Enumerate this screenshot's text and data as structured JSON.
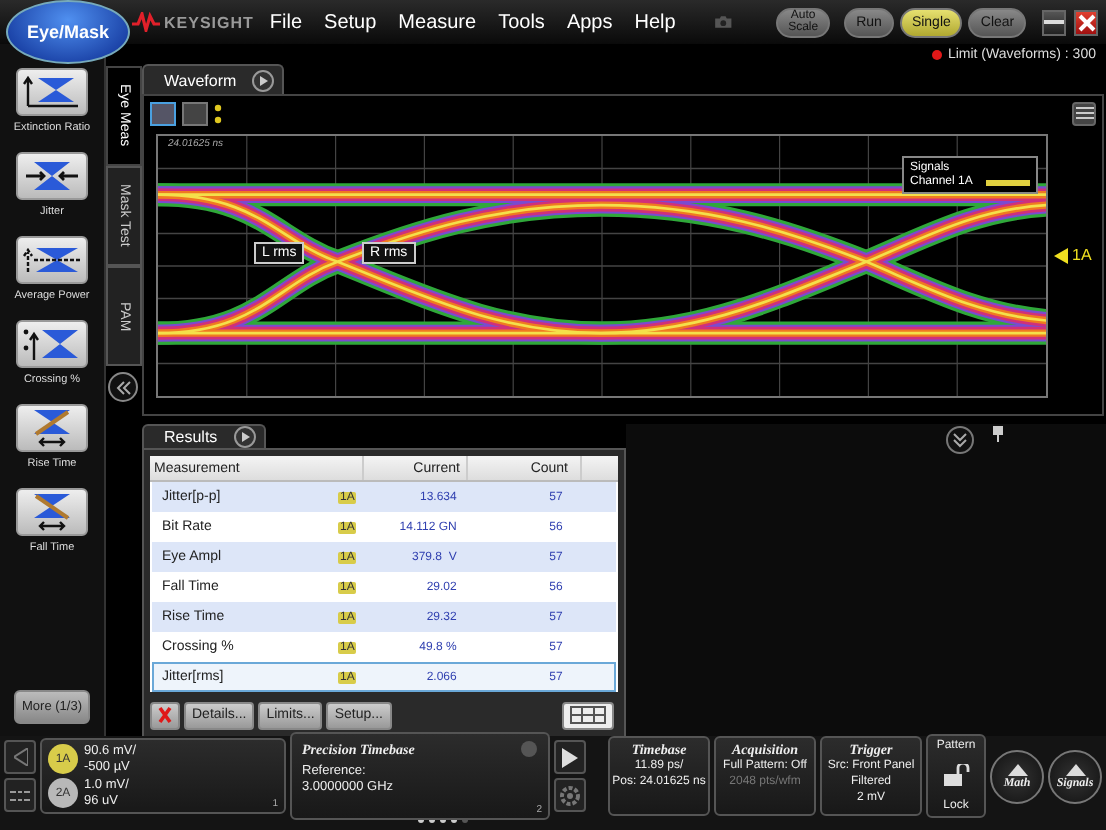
{
  "app_button": "Eye/Mask",
  "brand": "KEYSIGHT",
  "menu": [
    "File",
    "Setup",
    "Measure",
    "Tools",
    "Apps",
    "Help"
  ],
  "run_buttons": [
    {
      "label": "Auto Scale",
      "selected": false
    },
    {
      "label": "Run",
      "selected": false
    },
    {
      "label": "Single",
      "selected": true
    },
    {
      "label": "Clear",
      "selected": false
    }
  ],
  "limit_status": "Limit (Waveforms) : 300",
  "measure_buttons": [
    {
      "label": "Extinction Ratio",
      "kind": "extinction"
    },
    {
      "label": "Jitter",
      "kind": "jitter"
    },
    {
      "label": "Average Power",
      "kind": "power"
    },
    {
      "label": "Crossing %",
      "kind": "crossing"
    },
    {
      "label": "Rise Time",
      "kind": "rise"
    },
    {
      "label": "Fall Time",
      "kind": "fall"
    }
  ],
  "more_button": "More (1/3)",
  "side_tabs": [
    {
      "label": "Eye Meas",
      "selected": true
    },
    {
      "label": "Mask Test",
      "selected": false
    },
    {
      "label": "PAM",
      "selected": false
    }
  ],
  "waveform": {
    "tab": "Waveform",
    "timestamp": "24.01625 ns",
    "legend_title": "Signals",
    "legend_channel": "Channel 1A",
    "marker_left": "L rms",
    "marker_right": "R rms",
    "channel_marker": "1A"
  },
  "results": {
    "tab": "Results",
    "columns": [
      "Measurement",
      "Current",
      "Count"
    ],
    "rows": [
      {
        "name": "Jitter[p-p]",
        "source": "1A",
        "current": "13.634",
        "count": "57",
        "selected": false
      },
      {
        "name": "Bit Rate",
        "source": "1A",
        "current": "14.112 GN",
        "count": "56",
        "selected": false
      },
      {
        "name": "Eye Ampl",
        "source": "1A",
        "current": "379.8  V",
        "count": "57",
        "selected": false
      },
      {
        "name": "Fall Time",
        "source": "1A",
        "current": "29.02",
        "count": "56",
        "selected": false
      },
      {
        "name": "Rise Time",
        "source": "1A",
        "current": "29.32",
        "count": "57",
        "selected": false
      },
      {
        "name": "Crossing %",
        "source": "1A",
        "current": "49.8 %",
        "count": "57",
        "selected": false
      },
      {
        "name": "Jitter[rms]",
        "source": "1A",
        "current": "2.066",
        "count": "57",
        "selected": true
      }
    ],
    "buttons": [
      "Details...",
      "Limits...",
      "Setup..."
    ]
  },
  "channels": [
    {
      "label": "1A",
      "color": "#d8cc4a",
      "scale": "90.6 mV/",
      "offset": "-500 µV"
    },
    {
      "label": "2A",
      "color": "#b8b8b8",
      "scale": "1.0 mV/",
      "offset": "96 uV"
    }
  ],
  "channel_panel_index": "1",
  "timebase_panel": {
    "title": "Precision Timebase",
    "label": "Reference:",
    "value": "3.0000000 GHz",
    "index": "2"
  },
  "status_panels": [
    {
      "title": "Timebase",
      "lines": [
        "11.89 ps/",
        "Pos: 24.01625 ns"
      ]
    },
    {
      "title": "Acquisition",
      "lines": [
        "Full Pattern: Off",
        "2048 pts/wfm"
      ]
    },
    {
      "title": "Trigger",
      "lines": [
        "Src: Front Panel",
        "Filtered",
        "2 mV"
      ]
    }
  ],
  "pattern_lock": {
    "title": "Pattern",
    "label": "Lock"
  },
  "round_buttons": [
    "Math",
    "Signals"
  ]
}
